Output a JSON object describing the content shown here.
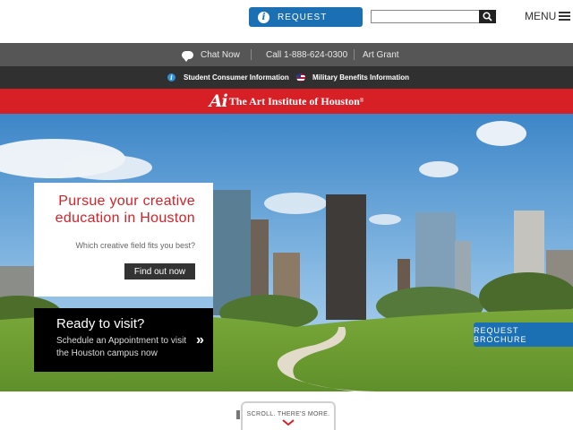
{
  "header": {
    "request_label": "REQUEST",
    "search_placeholder": "",
    "menu_label": "MENU"
  },
  "utility_bar": {
    "chat_label": "Chat Now",
    "phone_label": "Call 1-888-624-0300",
    "grant_label": "Art Grant"
  },
  "info_bar": {
    "consumer_info": "Student Consumer Information",
    "military_info": "Military Benefits Information"
  },
  "brand": {
    "logo_mark": "Ai",
    "name": "The Art Institute of Houston",
    "registered": "®"
  },
  "hero": {
    "promo_title": "Pursue your creative education in Houston",
    "promo_subtitle": "Which creative field fits you best?",
    "promo_button": "Find out now",
    "visit_title": "Ready to visit?",
    "visit_desc": "Schedule an Appointment to visit the Houston campus now",
    "visit_chevron": "»",
    "brochure_button": "REQUEST BROCHURE"
  },
  "scroll": {
    "label": "SCROLL. THERE'S MORE."
  },
  "colors": {
    "brand_red": "#d71f26",
    "action_blue": "#1b6fb3",
    "utility_grey": "#565656",
    "info_dark": "#303030"
  },
  "icons": [
    "info-icon",
    "search-icon",
    "menu-icon",
    "chat-icon",
    "flag-icon",
    "chevron-right-icon",
    "chevron-down-icon"
  ]
}
